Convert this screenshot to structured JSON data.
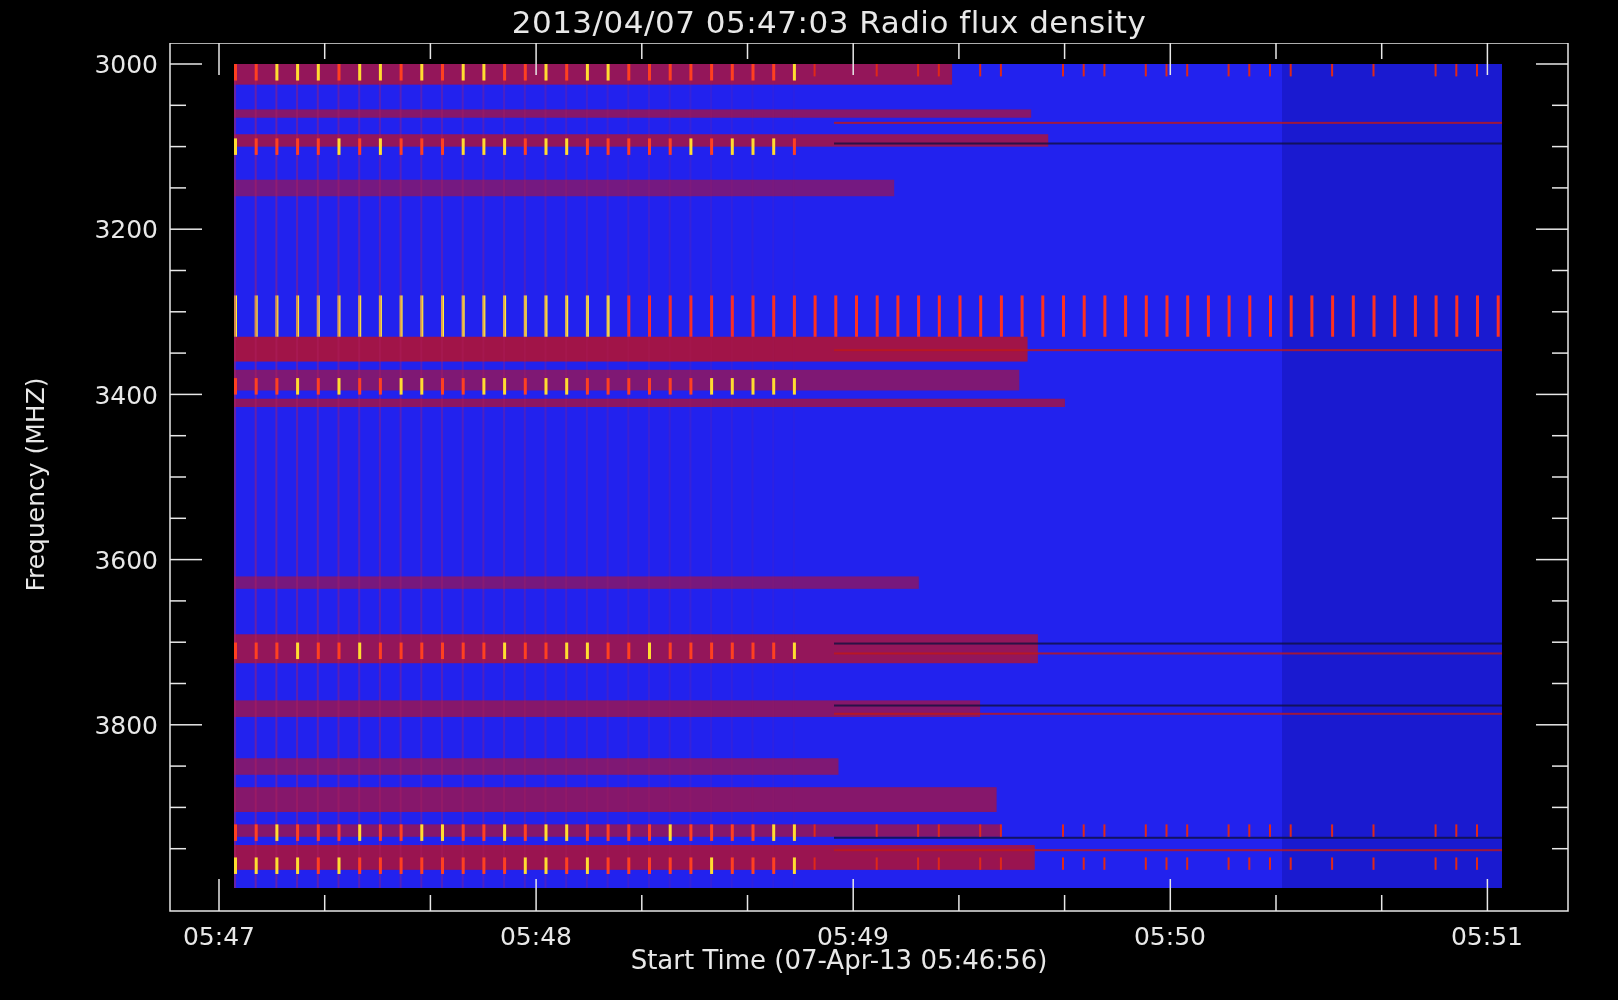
{
  "title": "2013/04/07 05:47:03 Radio flux density",
  "y_axis": {
    "label": "Frequency (MHZ)",
    "ticks": [
      "3000",
      "3200",
      "3400",
      "3600",
      "3800"
    ]
  },
  "x_axis": {
    "label": "Start Time (07-Apr-13 05:46:56)",
    "ticks": [
      "05:47",
      "05:48",
      "05:49",
      "05:50",
      "05:51"
    ]
  }
}
